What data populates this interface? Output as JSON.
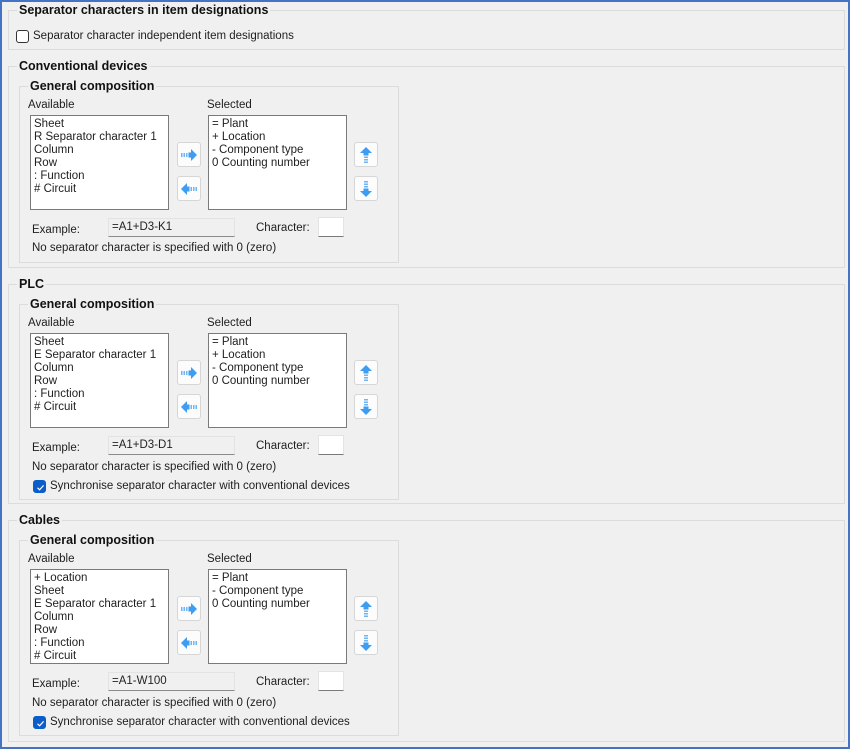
{
  "separator_section": {
    "title": "Separator characters in item designations",
    "independent_checkbox": {
      "label": "Separator character independent item designations",
      "checked": false
    }
  },
  "conventional": {
    "title": "Conventional devices",
    "composition_title": "General composition",
    "available_label": "Available",
    "selected_label": "Selected",
    "available": [
      "Sheet",
      "R Separator character 1",
      "Column",
      "Row",
      ": Function",
      "# Circuit"
    ],
    "selected": [
      "= Plant",
      "+ Location",
      "- Component type",
      "0 Counting number"
    ],
    "example_label": "Example:",
    "example_value": "=A1+D3-K1",
    "character_label": "Character:",
    "character_value": "",
    "note": "No separator character is specified with 0 (zero)"
  },
  "plc": {
    "title": "PLC",
    "composition_title": "General composition",
    "available_label": "Available",
    "selected_label": "Selected",
    "available": [
      "Sheet",
      "E Separator character 1",
      "Column",
      "Row",
      ": Function",
      "# Circuit"
    ],
    "selected": [
      "= Plant",
      "+ Location",
      "- Component type",
      "0 Counting number"
    ],
    "example_label": "Example:",
    "example_value": "=A1+D3-D1",
    "character_label": "Character:",
    "character_value": "",
    "note": "No separator character is specified with 0 (zero)",
    "sync_checkbox": {
      "label": "Synchronise separator character with conventional devices",
      "checked": true
    }
  },
  "cables": {
    "title": "Cables",
    "composition_title": "General composition",
    "available_label": "Available",
    "selected_label": "Selected",
    "available": [
      "+ Location",
      "Sheet",
      "E Separator character 1",
      "Column",
      "Row",
      ": Function",
      "# Circuit"
    ],
    "selected": [
      "= Plant",
      "- Component type",
      "0 Counting number"
    ],
    "example_label": "Example:",
    "example_value": "=A1-W100",
    "character_label": "Character:",
    "character_value": "",
    "note": "No separator character is specified with 0 (zero)",
    "sync_checkbox": {
      "label": "Synchronise separator character with conventional devices",
      "checked": true
    }
  },
  "icons": {
    "move_right": "arrow-right-icon",
    "move_left": "arrow-left-icon",
    "move_up": "arrow-up-icon",
    "move_down": "arrow-down-icon"
  },
  "colors": {
    "window_border": "#4472c4",
    "arrow_blue": "#3d9df3",
    "checkbox_checked": "#0b5ec9"
  }
}
